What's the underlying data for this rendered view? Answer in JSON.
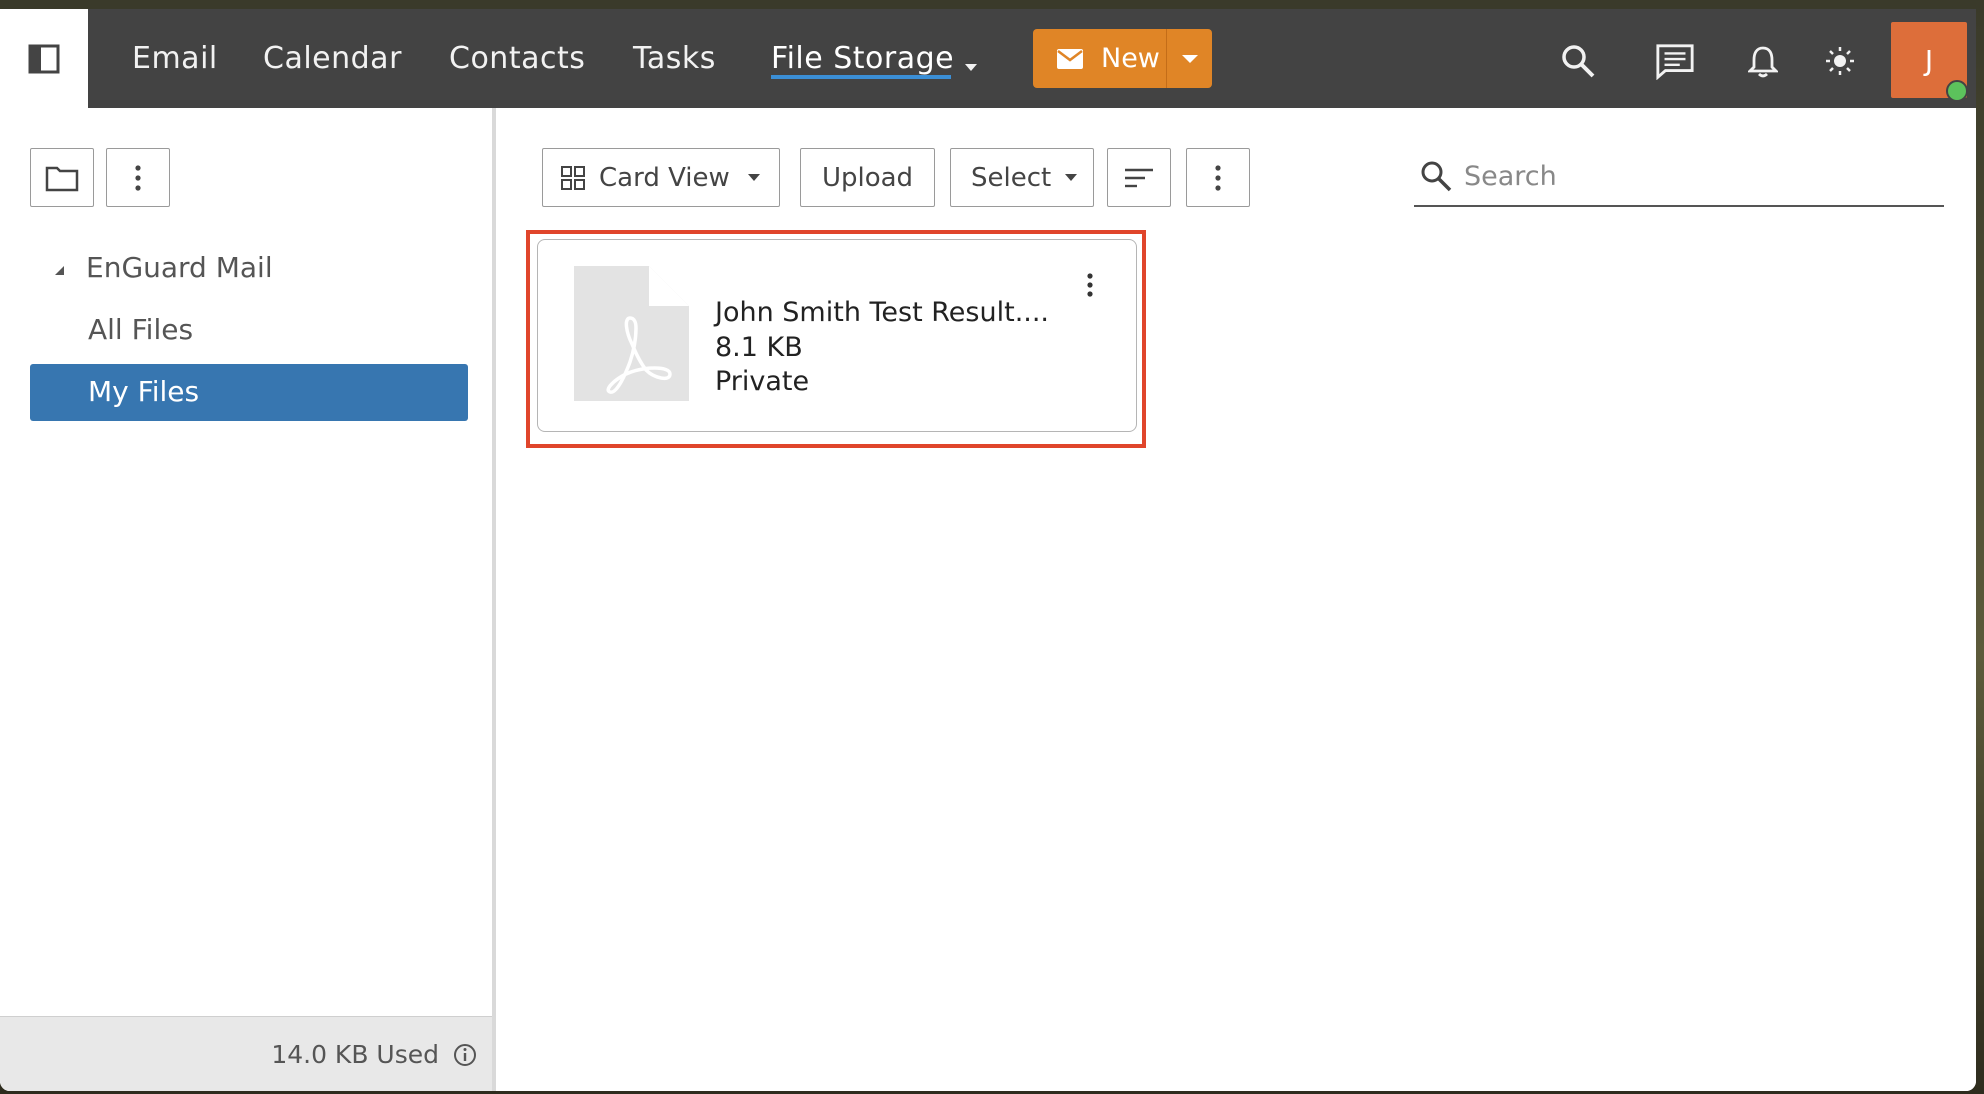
{
  "nav": {
    "items": [
      {
        "label": "Email"
      },
      {
        "label": "Calendar"
      },
      {
        "label": "Contacts"
      },
      {
        "label": "Tasks"
      },
      {
        "label": "File Storage"
      }
    ],
    "new_label": "New",
    "avatar_initial": "J"
  },
  "sidebar": {
    "tree_root": "EnGuard Mail",
    "items": [
      {
        "label": "All Files"
      },
      {
        "label": "My Files"
      }
    ],
    "storage_used": "14.0 KB Used"
  },
  "toolbar": {
    "view_label": "Card View",
    "upload_label": "Upload",
    "select_label": "Select",
    "search_placeholder": "Search"
  },
  "files": [
    {
      "name": "John Smith Test Result....",
      "size": "8.1 KB",
      "visibility": "Private"
    }
  ],
  "colors": {
    "topbar": "#434343",
    "accent_orange": "#e08526",
    "selected_blue": "#3776b0",
    "highlight_red": "#e0452b"
  }
}
